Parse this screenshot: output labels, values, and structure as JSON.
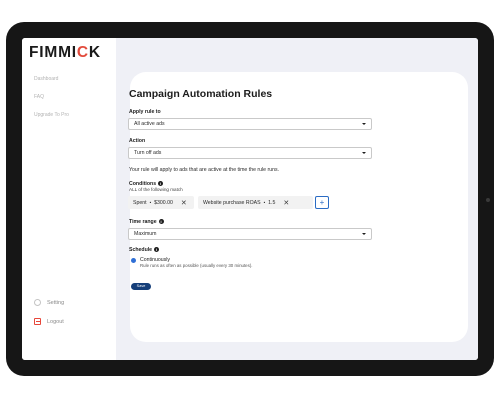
{
  "brand": {
    "logo_prefix": "FIMMI",
    "logo_accent": "C",
    "logo_suffix": "K"
  },
  "sidebar": {
    "items": [
      {
        "label": "Dashboard"
      },
      {
        "label": "FAQ"
      },
      {
        "label": "Upgrade To Pro"
      }
    ],
    "bottom": [
      {
        "label": "Setting",
        "icon": "gear-icon"
      },
      {
        "label": "Logout",
        "icon": "logout-icon"
      }
    ]
  },
  "page": {
    "title": "Campaign Automation Rules",
    "apply_rule": {
      "label": "Apply rule to",
      "value": "All active ads"
    },
    "action": {
      "label": "Action",
      "value": "Turn off ads"
    },
    "note": "Your rule will apply to ads that are active at the time the rule runs.",
    "conditions": {
      "label": "Conditions",
      "sub": "ALL of the following match",
      "items": [
        {
          "field": "Spent",
          "op": "•",
          "value": "$300.00"
        },
        {
          "field": "Website purchase ROAS",
          "op": "•",
          "value": "1.5"
        }
      ],
      "add_label": "+"
    },
    "time_range": {
      "label": "Time range",
      "value": "Maximum"
    },
    "schedule": {
      "label": "Schedule",
      "option": "Continuously",
      "desc": "Rule runs as often as possible (usually every 30 minutes)."
    },
    "save_label": "Save"
  },
  "colors": {
    "accent": "#e24a3b",
    "primary": "#163f7a",
    "link": "#2b6cc4",
    "background": "#eff0f6"
  }
}
